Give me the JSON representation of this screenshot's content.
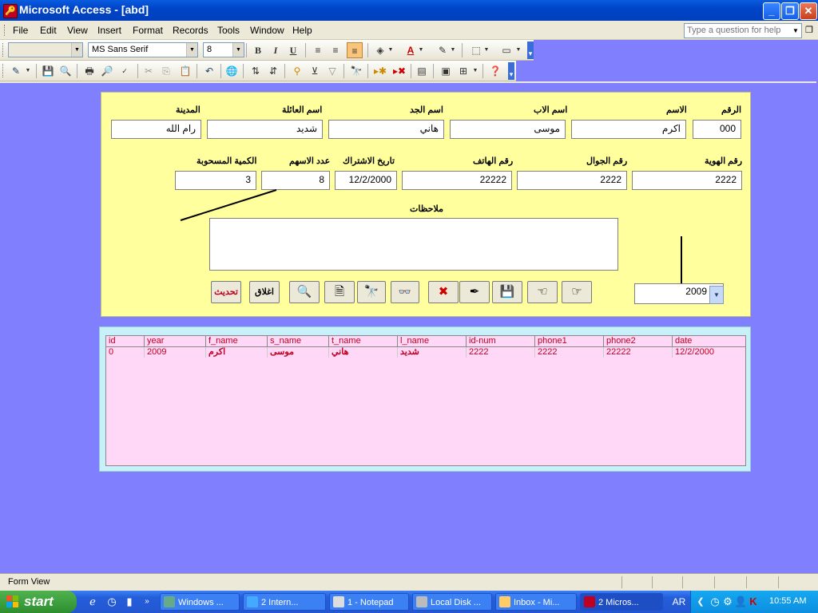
{
  "window": {
    "title": "Microsoft Access - [abd]",
    "min": "_",
    "max": "❐",
    "close": "✕"
  },
  "menu": {
    "items": [
      "File",
      "Edit",
      "View",
      "Insert",
      "Format",
      "Records",
      "Tools",
      "Window",
      "Help"
    ],
    "help_placeholder": "Type a question for help"
  },
  "toolbar1": {
    "object_combo": "",
    "font_combo": "MS Sans Serif",
    "size_combo": "8",
    "bold": "B",
    "italic": "I",
    "underline": "U"
  },
  "form": {
    "labels": {
      "raqm": "الرقم",
      "ism": "الاسم",
      "ism_al_ab": "اسم الاب",
      "ism_al_jadd": "اسم الجد",
      "ism_al_aila": "اسم العائلة",
      "madina": "المدينة",
      "raqm_hawiya": "رقم الهوية",
      "raqm_jawwal": "رقم الجوال",
      "raqm_hatif": "رقم الهاتف",
      "tarikh_ishtirak": "تاريخ الاشتراك",
      "adad_ashum": "عدد الاسهم",
      "kamiya": "الكمية المسحوبة",
      "mulahazat": "ملاحظات"
    },
    "values": {
      "raqm": "000",
      "ism": "اكرم",
      "ism_al_ab": "موسى",
      "ism_al_jadd": "هاني",
      "ism_al_aila": "شديد",
      "madina": "رام الله",
      "raqm_hawiya": "2222",
      "raqm_jawwal": "2222",
      "raqm_hatif": "22222",
      "tarikh_ishtirak": "12/2/2000",
      "adad_ashum": "8",
      "kamiya": "3",
      "mulahazat": "",
      "year": "2009"
    },
    "buttons": {
      "update": "تحديث",
      "close": "اغلاق"
    }
  },
  "grid": {
    "columns": [
      "id",
      "year",
      "f_name",
      "s_name",
      "t_name",
      "l_name",
      "id-num",
      "phone1",
      "phone2",
      "date"
    ],
    "rows": [
      [
        "0",
        "2009",
        "اكرم",
        "موسى",
        "هاني",
        "شديد",
        "2222",
        "2222",
        "22222",
        "12/2/2000"
      ]
    ]
  },
  "status": {
    "text": "Form View"
  },
  "taskbar": {
    "start": "start",
    "tasks": [
      "Windows ...",
      "2 Intern...",
      "1 - Notepad",
      "Local Disk ...",
      "Inbox - Mi...",
      "2 Micros..."
    ],
    "lang": "AR",
    "clock": "10:55 AM"
  },
  "colors": {
    "form_bg": "#ffff9e",
    "workspace_bg": "#8080ff",
    "grid_bg": "#ffd8f8",
    "grid_text": "#c00020"
  }
}
